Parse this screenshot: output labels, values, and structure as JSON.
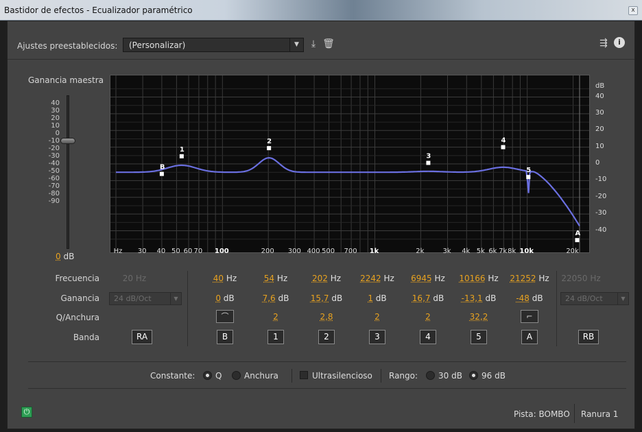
{
  "window": {
    "title": "Bastidor de efectos - Ecualizador paramétrico",
    "close_glyph": "x"
  },
  "presets": {
    "label": "Ajustes preestablecidos:",
    "value": "(Personalizar)"
  },
  "master": {
    "label": "Ganancia maestra",
    "value": "0",
    "unit": "dB",
    "scale": [
      "40",
      "30",
      "20",
      "10",
      "0",
      "-10",
      "-20",
      "-30",
      "-40",
      "-50",
      "-60",
      "-70",
      "-80",
      "-90"
    ]
  },
  "graph": {
    "freq_ticks": [
      "Hz",
      "30",
      "40",
      "50",
      "60",
      "70",
      "100",
      "200",
      "300",
      "400",
      "500",
      "700",
      "1k",
      "2k",
      "3k",
      "4k",
      "5k",
      "6k",
      "7k",
      "8k",
      "10k",
      "20k"
    ],
    "db_ticks": [
      "dB",
      "40",
      "30",
      "20",
      "10",
      "0",
      "-10",
      "-20",
      "-30",
      "-40"
    ],
    "node_labels": [
      "B",
      "1",
      "2",
      "3",
      "4",
      "5",
      "A"
    ]
  },
  "params": {
    "row_labels": {
      "freq": "Frecuencia",
      "gain": "Ganancia",
      "q": "Q/Anchura",
      "band": "Banda"
    },
    "low_cut": {
      "freq": "20",
      "unit": "Hz",
      "slope": "24 dB/Oct",
      "band": "RA"
    },
    "high_cut": {
      "freq": "22050",
      "unit": "Hz",
      "slope": "24 dB/Oct",
      "band": "RB"
    },
    "bands": [
      {
        "freq": "40",
        "gain": "0",
        "q": "",
        "band": "B"
      },
      {
        "freq": "54",
        "gain": "7,6",
        "q": "2",
        "band": "1"
      },
      {
        "freq": "202",
        "gain": "15,7",
        "q": "2,8",
        "band": "2"
      },
      {
        "freq": "2242",
        "gain": "1",
        "q": "2",
        "band": "3"
      },
      {
        "freq": "6945",
        "gain": "16,7",
        "q": "2",
        "band": "4"
      },
      {
        "freq": "10166",
        "gain": "-13,1",
        "q": "32,2",
        "band": "5"
      },
      {
        "freq": "21252",
        "gain": "-48",
        "q": "",
        "band": "A"
      }
    ],
    "units": {
      "hz": "Hz",
      "db": "dB"
    }
  },
  "options": {
    "constant_label": "Constante:",
    "q_label": "Q",
    "width_label": "Anchura",
    "ultra_label": "Ultrasilencioso",
    "range_label": "Rango:",
    "range_30": "30 dB",
    "range_96": "96 dB"
  },
  "footer": {
    "track": "Pista: BOMBO",
    "slot": "Ranura 1"
  },
  "colors": {
    "accent": "#e8a21f",
    "curve": "#6a6fe0",
    "power": "#2e9e55"
  },
  "icons": {
    "export": "export-icon",
    "trash": "trash-icon",
    "routing": "routing-icon",
    "info": "info-icon"
  }
}
